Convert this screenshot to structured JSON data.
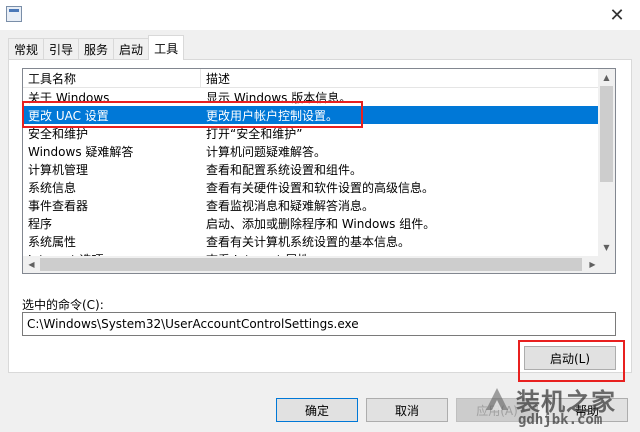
{
  "window": {
    "close_glyph": "✕"
  },
  "tabs": [
    {
      "label": "常规"
    },
    {
      "label": "引导"
    },
    {
      "label": "服务"
    },
    {
      "label": "启动"
    },
    {
      "label": "工具"
    }
  ],
  "tools_list": {
    "columns": {
      "name": "工具名称",
      "description": "描述"
    },
    "rows": [
      {
        "name": "关于 Windows",
        "description": "显示 Windows 版本信息。"
      },
      {
        "name": "更改 UAC 设置",
        "description": "更改用户帐户控制设置。",
        "selected": true
      },
      {
        "name": "安全和维护",
        "description": "打开“安全和维护”"
      },
      {
        "name": "Windows 疑难解答",
        "description": "计算机问题疑难解答。"
      },
      {
        "name": "计算机管理",
        "description": "查看和配置系统设置和组件。"
      },
      {
        "name": "系统信息",
        "description": "查看有关硬件设置和软件设置的高级信息。"
      },
      {
        "name": "事件查看器",
        "description": "查看监视消息和疑难解答消息。"
      },
      {
        "name": "程序",
        "description": "启动、添加或删除程序和 Windows 组件。"
      },
      {
        "name": "系统属性",
        "description": "查看有关计算机系统设置的基本信息。"
      },
      {
        "name": "Internet 选项",
        "description": "查看 Internet 属性。"
      }
    ]
  },
  "command": {
    "label": "选中的命令(C):",
    "value": "C:\\Windows\\System32\\UserAccountControlSettings.exe"
  },
  "buttons": {
    "launch": "启动(L)",
    "ok": "确定",
    "cancel": "取消",
    "apply": "应用(A)",
    "help": "帮助"
  },
  "watermark": {
    "title": "装机之家",
    "url": "gdhjbk.com"
  },
  "colors": {
    "selection": "#0078d7",
    "highlight": "#e8201f"
  }
}
